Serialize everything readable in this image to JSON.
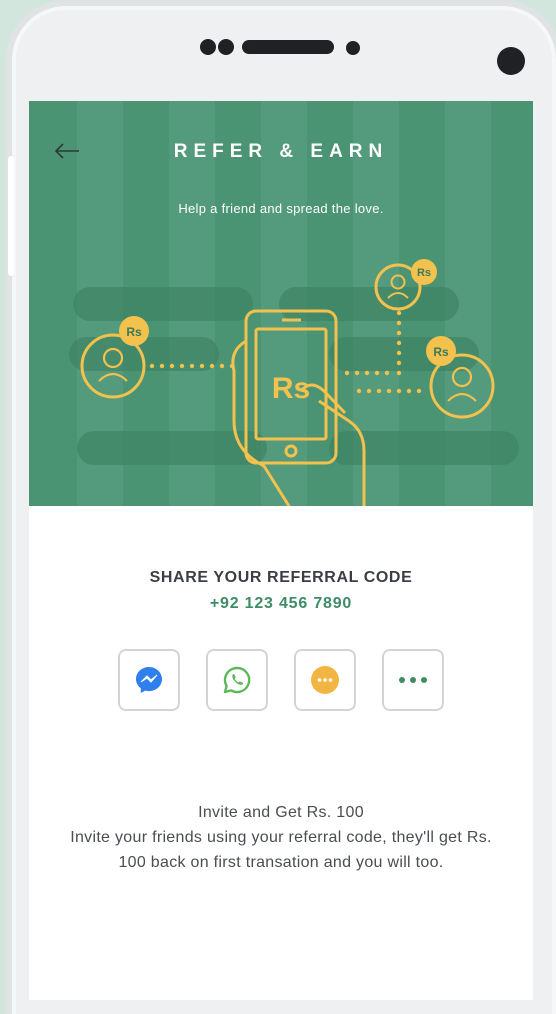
{
  "header": {
    "title": "REFER & EARN",
    "subtitle": "Help a friend and spread the love.",
    "back_icon": "arrow-left-icon"
  },
  "illustration": {
    "currency_badge": "Rs",
    "phone_label": "Rs"
  },
  "referral": {
    "heading": "SHARE YOUR REFERRAL CODE",
    "code": "+92 123 456 7890"
  },
  "share_options": [
    {
      "icon": "messenger-icon",
      "color": "#2f80ed"
    },
    {
      "icon": "whatsapp-icon",
      "color": "#5fb85a"
    },
    {
      "icon": "sms-chat-icon",
      "color": "#f2b544"
    },
    {
      "icon": "more-options-icon",
      "color": "#3f8c67"
    }
  ],
  "info": {
    "title": "Invite and Get Rs. 100",
    "body": "Invite your friends using your referral code, they'll get Rs. 100 back on first transation and you will too."
  },
  "colors": {
    "hero_bg": "#4a9474",
    "accent": "#f2c14e",
    "code_green": "#3f8c67"
  }
}
